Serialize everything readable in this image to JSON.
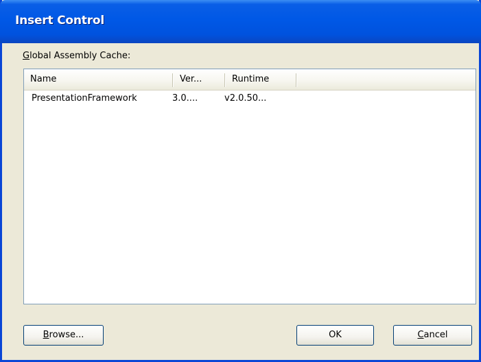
{
  "window": {
    "title": "Insert Control"
  },
  "gac": {
    "label_mnemonic": "G",
    "label_rest": "lobal Assembly Cache:"
  },
  "list": {
    "columns": [
      "Name",
      "Ver...",
      "Runtime"
    ],
    "rows": [
      {
        "name": "PresentationFramework",
        "version": "3.0....",
        "runtime": "v2.0.50..."
      }
    ]
  },
  "buttons": {
    "browse_mnemonic": "B",
    "browse_rest": "rowse...",
    "ok": "OK",
    "cancel_mnemonic": "C",
    "cancel_rest": "ancel"
  }
}
